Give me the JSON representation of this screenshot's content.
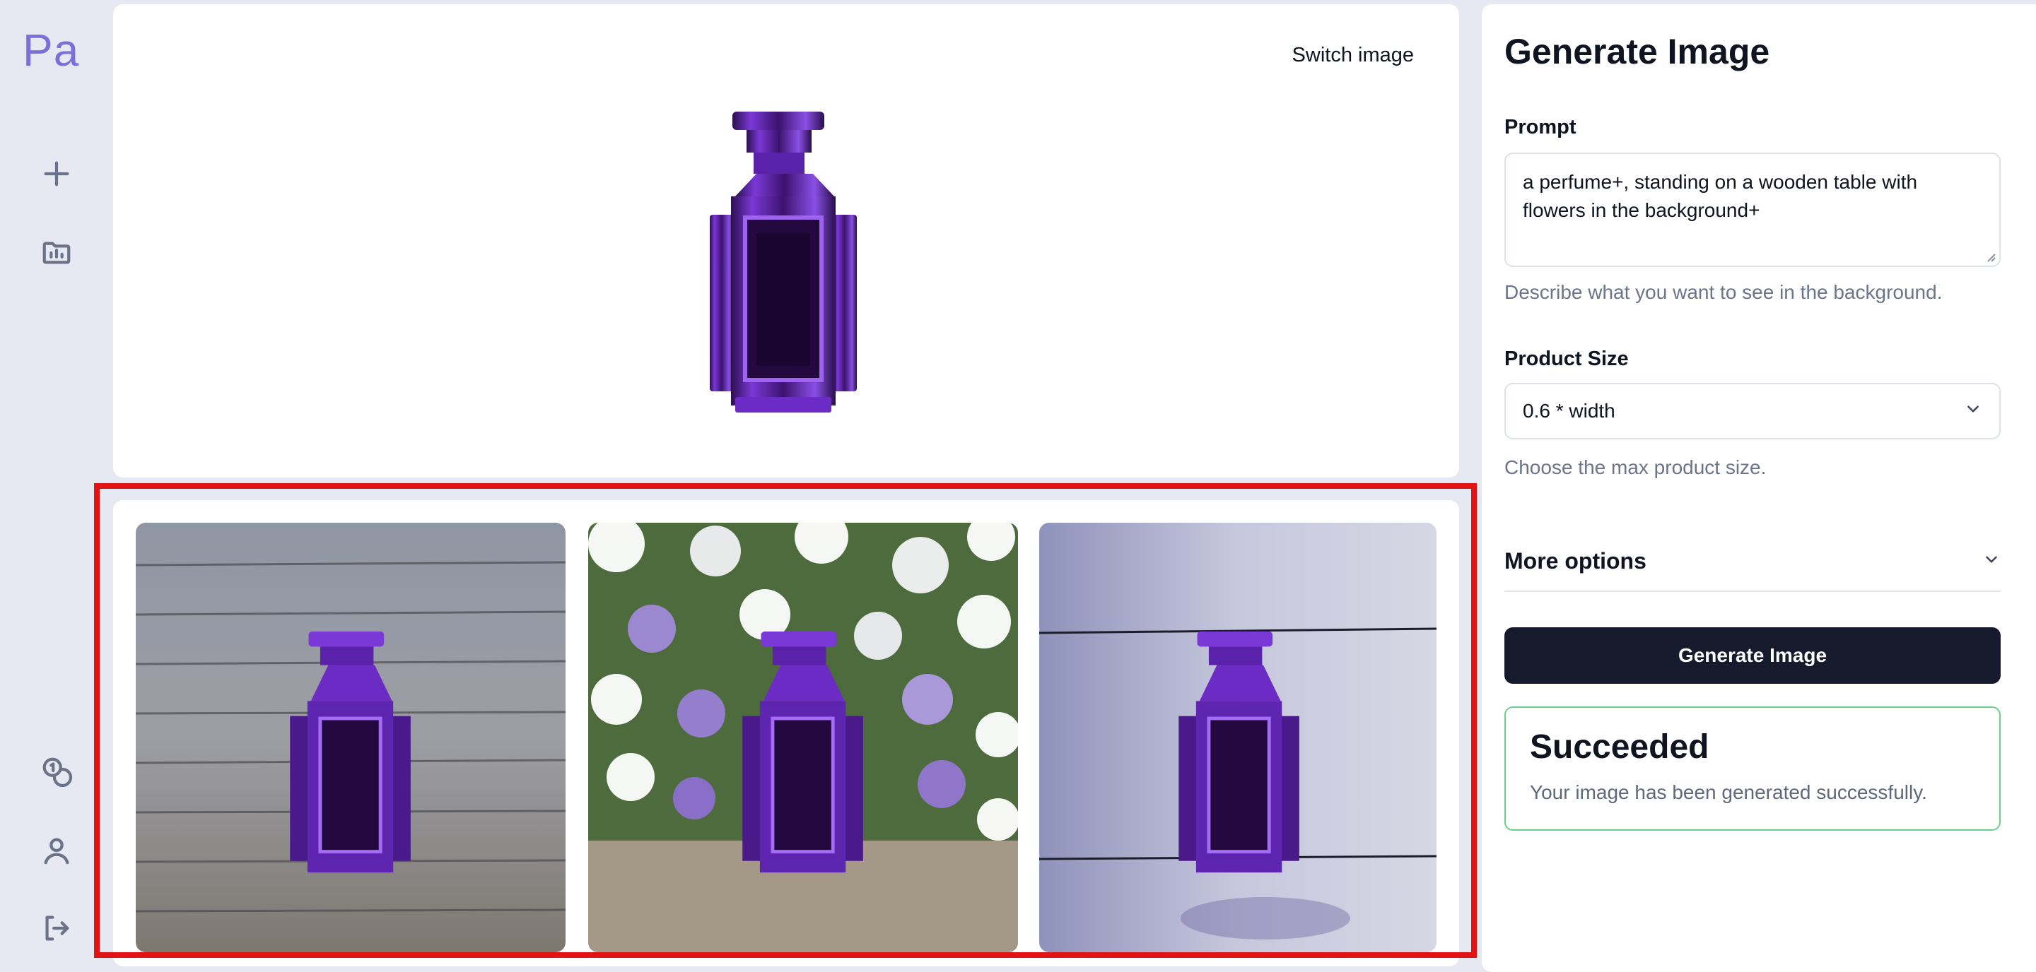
{
  "sidebar": {
    "logo": "Pa",
    "icons": [
      "plus-icon",
      "folder-chart-icon",
      "coins-icon",
      "user-icon",
      "logout-icon"
    ]
  },
  "preview": {
    "switch_label": "Switch image"
  },
  "results": {
    "items": [
      {
        "name": "result-wooden-table"
      },
      {
        "name": "result-flowers-background"
      },
      {
        "name": "result-wood-planks"
      }
    ]
  },
  "form": {
    "title": "Generate Image",
    "prompt_label": "Prompt",
    "prompt_value": "a perfume+, standing on a wooden table with flowers in the background+",
    "prompt_hint": "Describe what you want to see in the background.",
    "size_label": "Product Size",
    "size_value": "0.6 * width",
    "size_hint": "Choose the max product size.",
    "more_options": "More options",
    "generate_button": "Generate Image"
  },
  "status": {
    "title": "Succeeded",
    "message": "Your image has been generated successfully."
  },
  "colors": {
    "accent": "#7d6ed9",
    "button": "#151b2c",
    "success_border": "#6dd18a",
    "highlight": "#e11313"
  }
}
